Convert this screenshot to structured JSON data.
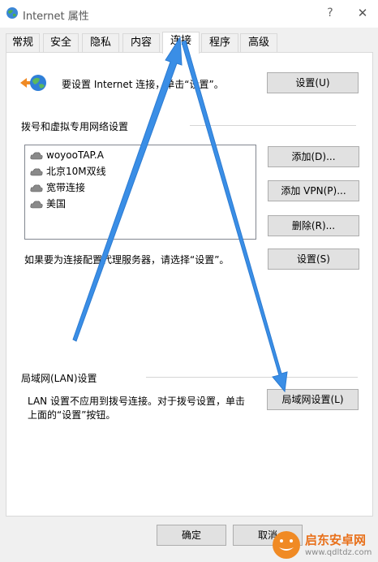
{
  "window": {
    "title": "Internet 属性",
    "help": "?",
    "close": "✕",
    "icon": "globe-icon"
  },
  "tabs": [
    "常规",
    "安全",
    "隐私",
    "内容",
    "连接",
    "程序",
    "高级"
  ],
  "active_tab": "连接",
  "setup": {
    "text": "要设置 Internet 连接，单击“设置”。",
    "button": "设置(U)"
  },
  "dialup": {
    "heading": "拨号和虚拟专用网络设置",
    "connections": [
      "woyooTAP.A",
      "北京10M双线",
      "宽带连接",
      "美国"
    ],
    "add_button": "添加(D)...",
    "add_vpn_button": "添加 VPN(P)...",
    "remove_button": "删除(R)...",
    "proxy_text": "如果要为连接配置代理服务器，请选择“设置”。",
    "settings_button": "设置(S)"
  },
  "lan": {
    "heading": "局域网(LAN)设置",
    "text_line1": "LAN 设置不应用到拨号连接。对于拨号设置，单击",
    "text_line2": "上面的“设置”按钮。",
    "button": "局域网设置(L)"
  },
  "footer": {
    "ok": "确定",
    "cancel": "取消"
  },
  "watermark": {
    "brand": "启东安卓网",
    "url": "www.qdltdz.com"
  },
  "colors": {
    "arrow": "#3a8ee6",
    "watermark_orange": "#f08a24"
  }
}
